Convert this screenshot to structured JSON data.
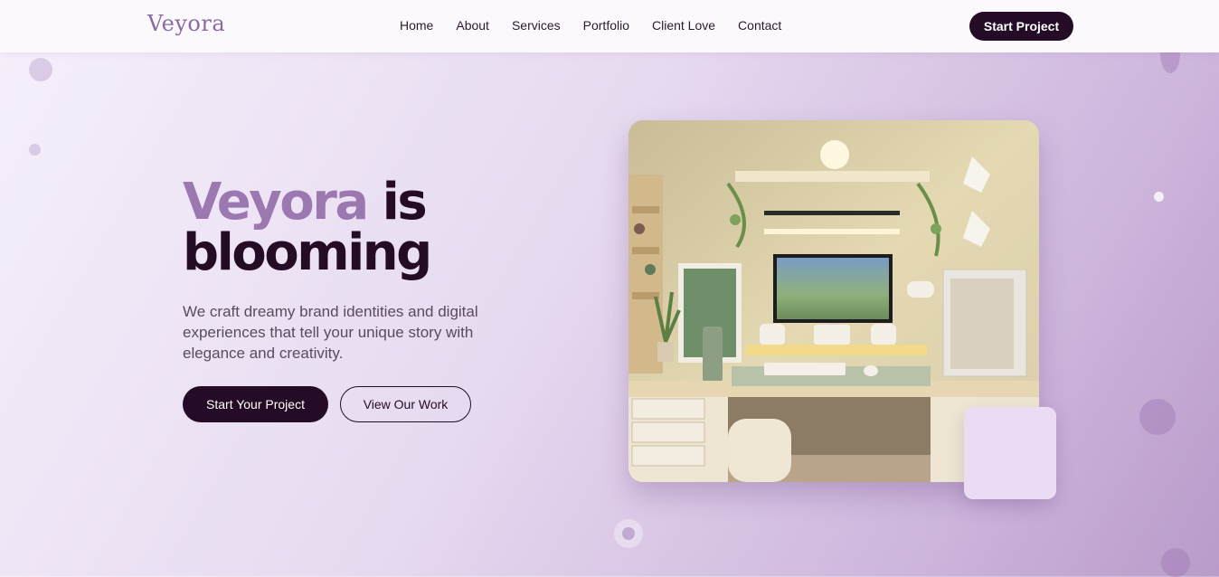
{
  "brand": {
    "logo_text": "Veyora"
  },
  "nav": {
    "items": [
      {
        "label": "Home"
      },
      {
        "label": "About"
      },
      {
        "label": "Services"
      },
      {
        "label": "Portfolio"
      },
      {
        "label": "Client Love"
      },
      {
        "label": "Contact"
      }
    ],
    "cta_label": "Start Project"
  },
  "hero": {
    "headline_accent": "Veyora",
    "headline_rest_1": " is",
    "headline_line_2": "blooming",
    "subtitle": "We craft dreamy brand identities and digital experiences that tell your unique story with elegance and creativity.",
    "primary_button": "Start Your Project",
    "secondary_button": "View Our Work",
    "image_subject": "cozy-desk-setup-photo"
  },
  "colors": {
    "primary_dark": "#240c26",
    "accent_purple": "#9c78b0",
    "logo_purple": "#8a6aa3",
    "background_light": "#f6f0fb",
    "background_deep": "#b99bc9"
  }
}
